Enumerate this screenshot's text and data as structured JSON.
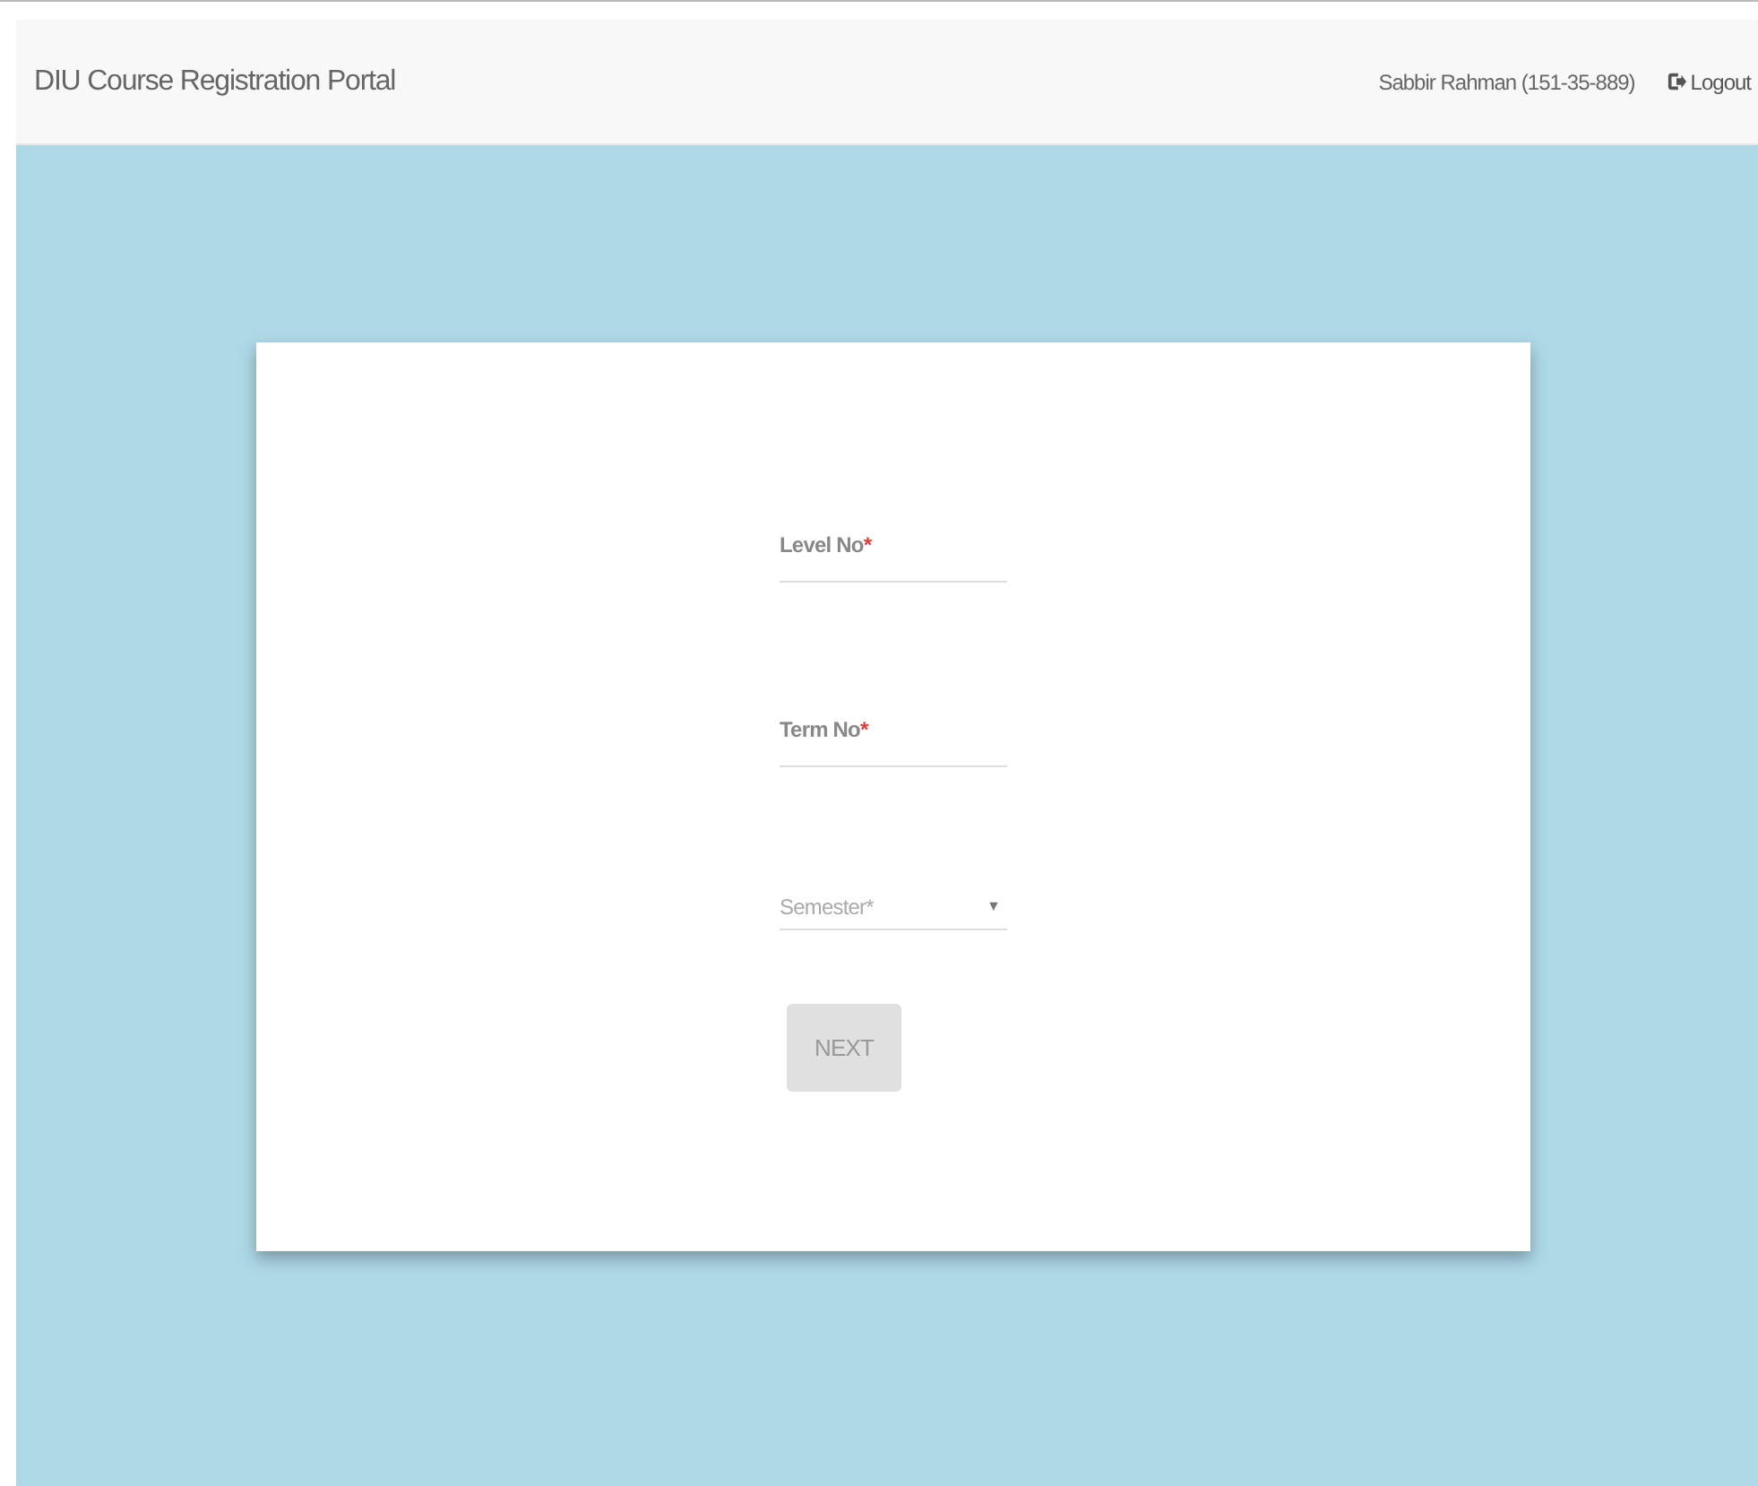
{
  "navbar": {
    "brand": "DIU Course Registration Portal",
    "user": "Sabbir Rahman (151-35-889)",
    "logout": "Logout"
  },
  "form": {
    "fields": [
      {
        "kind": "text",
        "label": "Level No",
        "required_mark": "*"
      },
      {
        "kind": "text",
        "label": "Term No",
        "required_mark": "*"
      },
      {
        "kind": "select",
        "placeholder": "Semester*",
        "caret": "▼"
      }
    ],
    "button": {
      "label": "NEXT",
      "disabled": true
    }
  }
}
